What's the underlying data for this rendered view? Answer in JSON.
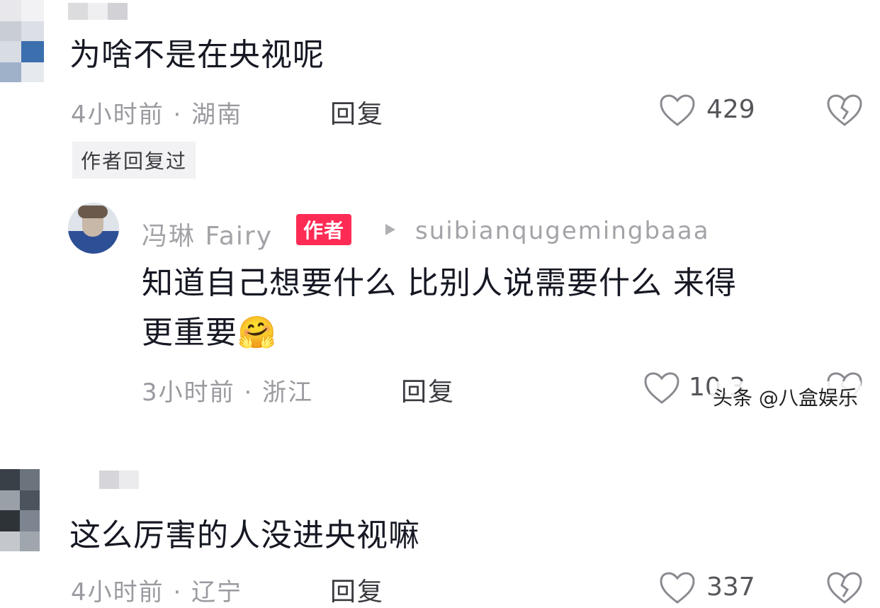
{
  "comments": [
    {
      "text": "为啥不是在央视呢",
      "time": "4小时前",
      "region": "湖南",
      "reply_label": "回复",
      "likes": "429",
      "author_replied_badge": "作者回复过"
    },
    {
      "text": "这么厉害的人没进央视嘛",
      "time": "4小时前",
      "region": "辽宁",
      "reply_label": "回复",
      "likes": "337"
    }
  ],
  "author_reply": {
    "username": "冯琳 Fairy",
    "author_tag": "作者",
    "reply_to": "suibianqugemingbaaa",
    "text_line1": "知道自己想要什么 比别人说需要什么 来得",
    "text_line2": "更重要",
    "emoji": "🤗",
    "time": "3小时前",
    "region": "浙江",
    "reply_label": "回复",
    "likes": "10.3"
  },
  "separator": "·",
  "watermark": "头条 @八盒娱乐",
  "icons": {
    "like": "heart-icon",
    "dislike": "broken-heart-icon",
    "arrow": "play-triangle-icon"
  },
  "colors": {
    "author_tag_bg": "#fe2c55",
    "meta_text": "#9a9aa0"
  }
}
